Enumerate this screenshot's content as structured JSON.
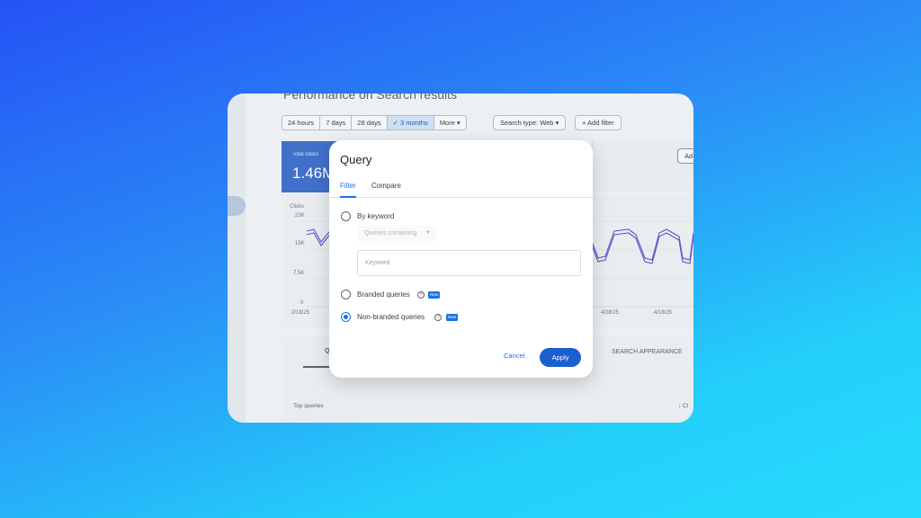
{
  "background_page": {
    "title": "Performance on Search results",
    "date_chips": [
      "24 hours",
      "7 days",
      "28 days",
      "3 months"
    ],
    "active_chip": "3 months",
    "more_label": "More",
    "search_type_label": "Search type: Web",
    "add_filter_label": "+ Add filter",
    "metric": {
      "label": "Total clicks",
      "value": "1.46M"
    },
    "side_button_label": "Ad",
    "chart": {
      "y_axis_title": "Clicks",
      "y_ticks": [
        "23K",
        "15K",
        "7.5K",
        "0"
      ],
      "x_ticks": [
        "2/18/25",
        "4/28/25",
        "4/18/25"
      ]
    },
    "tab_search_appearance": "SEARCH APPEARANCE",
    "tab_q_fragment": "Q",
    "top_queries_label": "Top queries",
    "sort_fragment": "↓ Cl"
  },
  "dialog": {
    "title": "Query",
    "tabs": [
      {
        "label": "Filter",
        "active": true
      },
      {
        "label": "Compare",
        "active": false
      }
    ],
    "options": [
      {
        "label": "By keyword",
        "checked": false,
        "badge": ""
      },
      {
        "label": "Branded queries",
        "checked": false,
        "badge": "New"
      },
      {
        "label": "Non-branded queries",
        "checked": true,
        "badge": "New"
      }
    ],
    "match_select": "Queries containing",
    "keyword_placeholder": "Keyword",
    "cancel_label": "Cancel",
    "apply_label": "Apply"
  },
  "colors": {
    "accent": "#1a73e8",
    "apply_button": "#1a5fd0",
    "metric_card": "#4170cb",
    "clicks_line": "#4a5bd0",
    "impressions_line": "#6f4dc4"
  }
}
